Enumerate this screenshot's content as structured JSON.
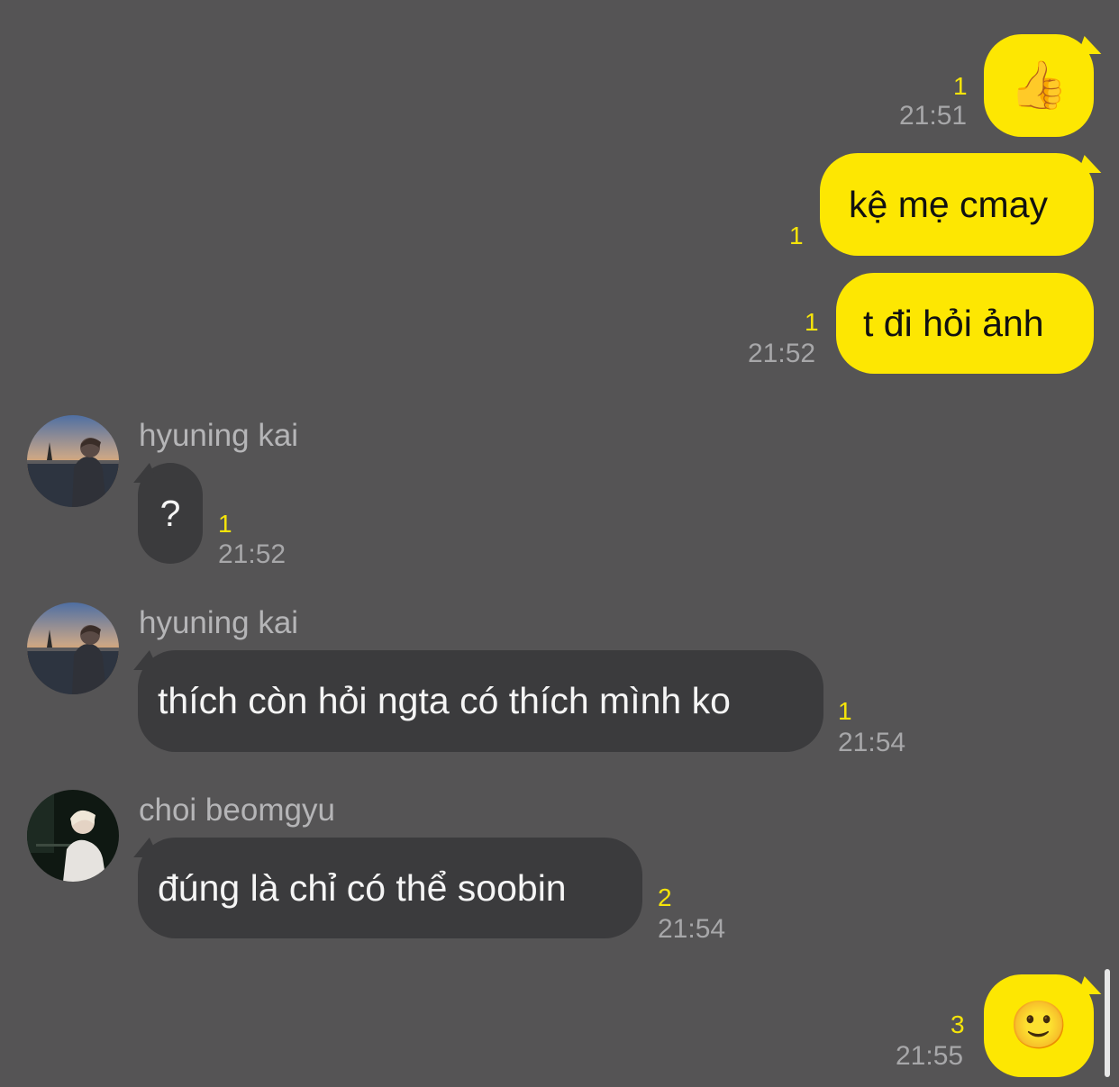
{
  "messages": [
    {
      "direction": "outgoing",
      "content_icon": "thumbs-up-emoji",
      "unread": "1",
      "time": "21:51"
    },
    {
      "direction": "outgoing",
      "text": "kệ mẹ cmay",
      "unread": "1"
    },
    {
      "direction": "outgoing",
      "text": "t đi hỏi ảnh",
      "unread": "1",
      "time": "21:52"
    },
    {
      "direction": "incoming",
      "sender": "hyuning kai",
      "text": "?",
      "unread": "1",
      "time": "21:52"
    },
    {
      "direction": "incoming",
      "sender": "hyuning kai",
      "text": "thích còn hỏi ngta có thích mình ko",
      "unread": "1",
      "time": "21:54"
    },
    {
      "direction": "incoming",
      "sender": "choi beomgyu",
      "text": "đúng là chỉ có thể soobin",
      "unread": "2",
      "time": "21:54"
    },
    {
      "direction": "outgoing",
      "content_icon": "smiling-face-emoji",
      "unread": "3",
      "time": "21:55"
    }
  ],
  "emoji": {
    "thumbs_up": "👍",
    "smile": "🙂"
  },
  "colors": {
    "background": "#555455",
    "outgoing_bubble": "#fde702",
    "incoming_bubble": "#3b3b3d",
    "unread_count": "#f5e40a",
    "timestamp": "#a7a7a9",
    "sender_name": "#b5b5b7"
  }
}
